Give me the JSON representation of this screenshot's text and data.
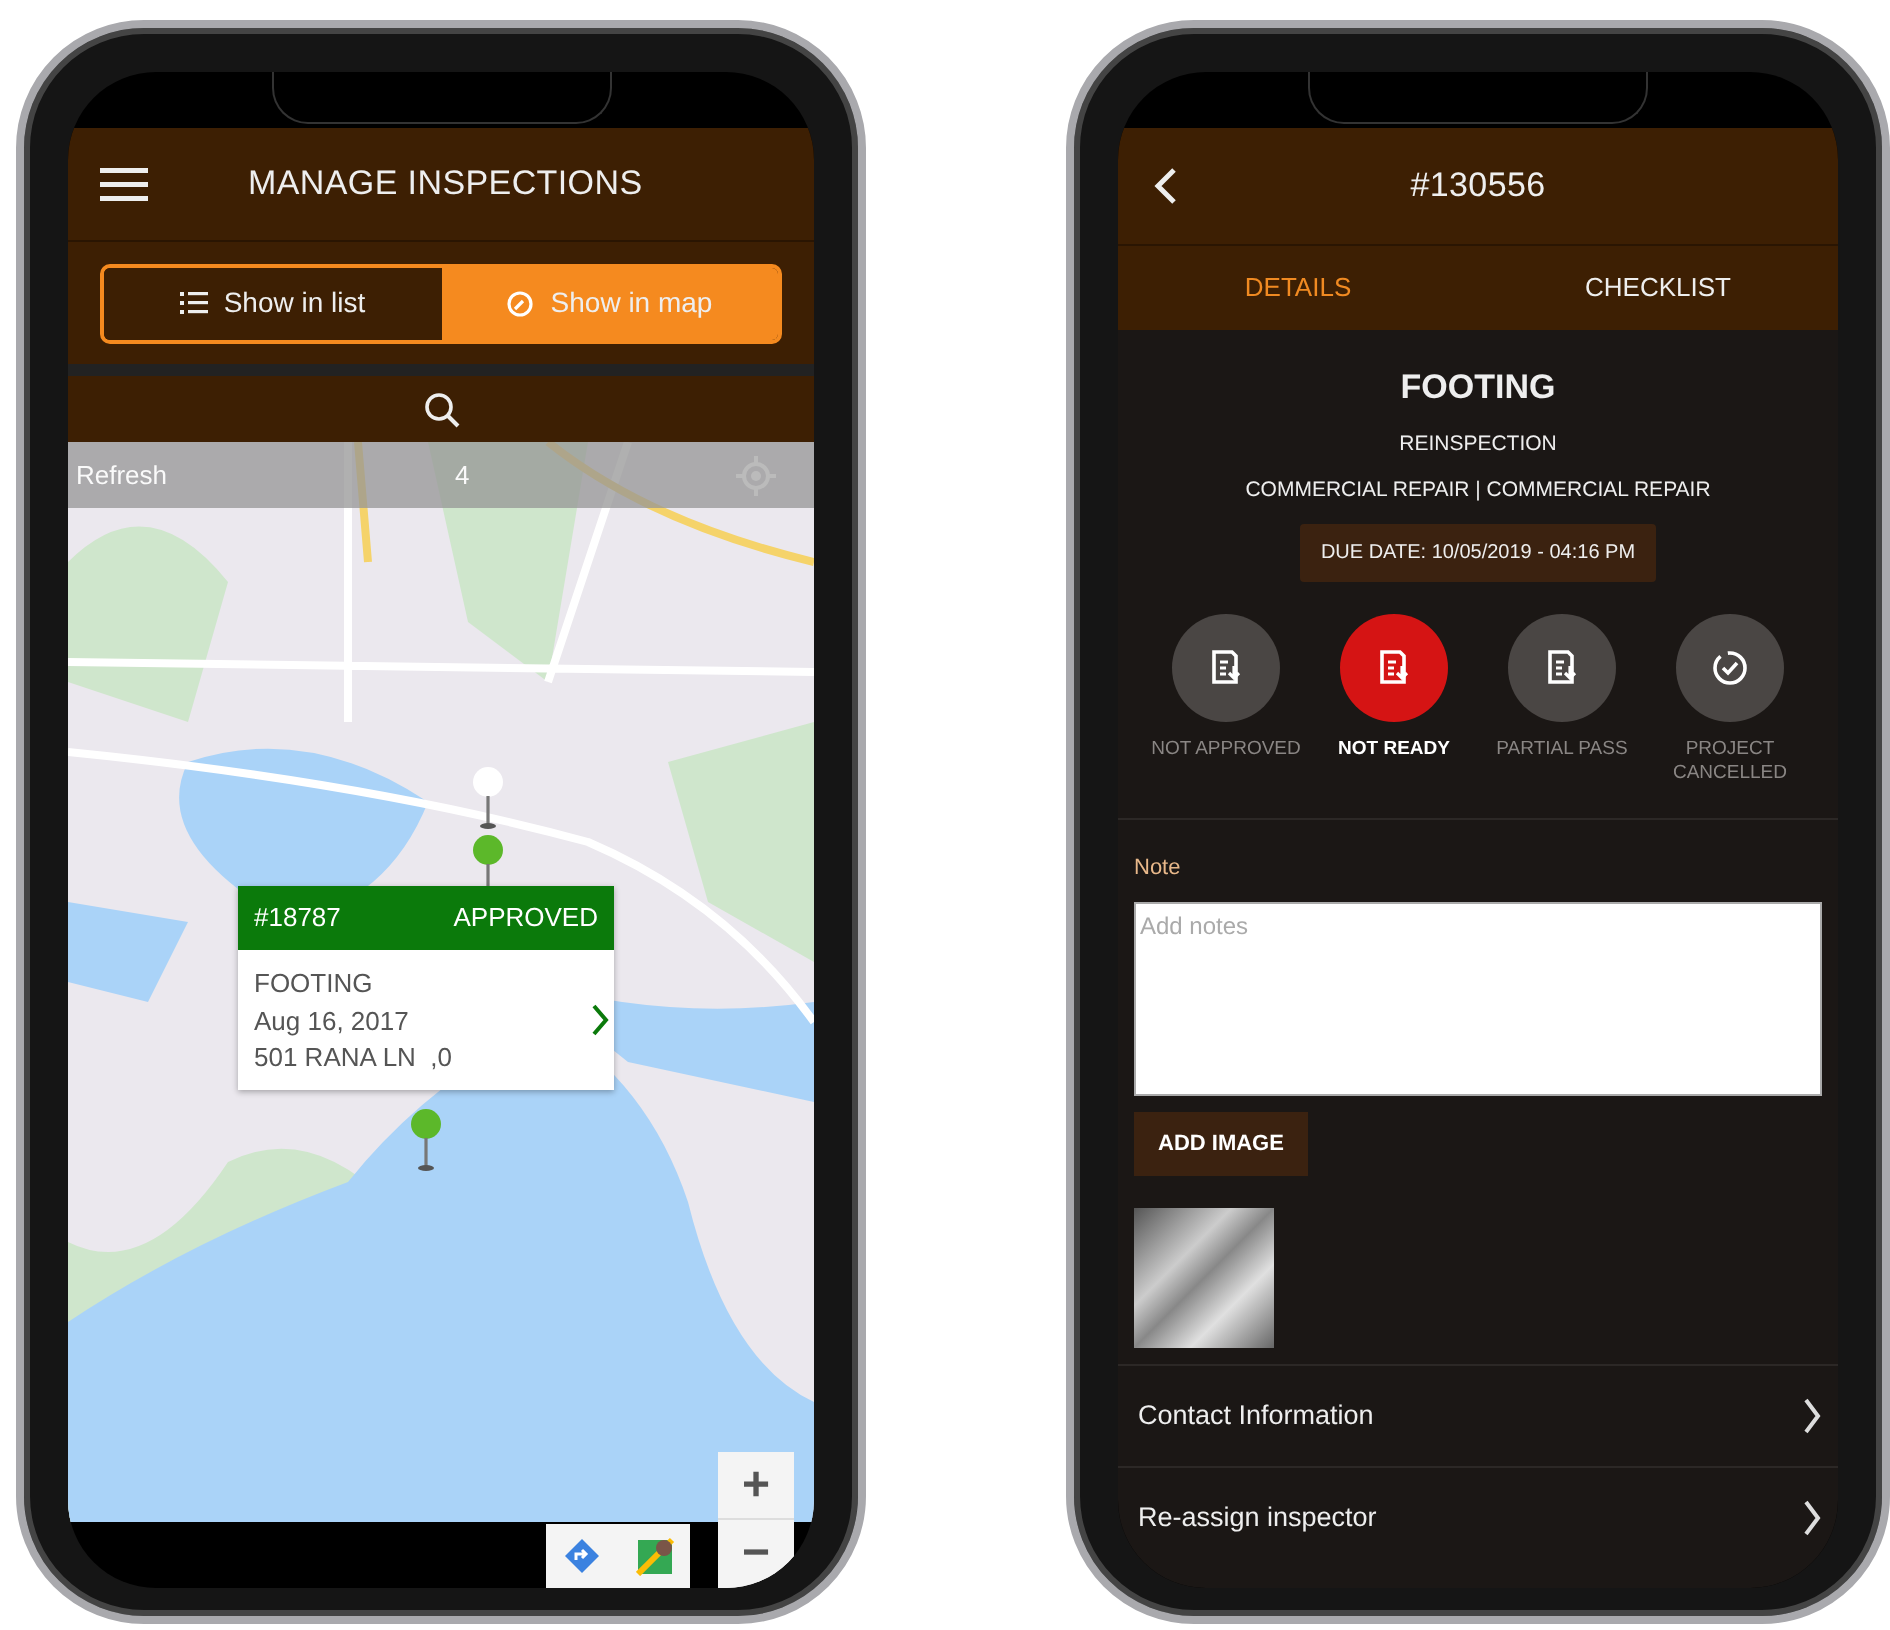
{
  "map_screen": {
    "title": "MANAGE INSPECTIONS",
    "view_toggle": [
      {
        "label": "Show in list",
        "selected": false,
        "kind": "list"
      },
      {
        "label": "Show in map",
        "selected": true,
        "kind": "map"
      }
    ],
    "refresh_bar": {
      "label": "Refresh",
      "count": "4"
    },
    "popup": {
      "number": "#18787",
      "status": "APPROVED",
      "title": "FOOTING",
      "date": "Aug 16, 2017",
      "address": "501 RANA LN  ,0"
    },
    "zoom_controls": [
      "+",
      "−"
    ]
  },
  "detail_screen": {
    "title": "#130556",
    "tabs": [
      {
        "label": "DETAILS",
        "selected": true
      },
      {
        "label": "CHECKLIST",
        "selected": false
      }
    ],
    "heading": "FOOTING",
    "subtitle": "REINSPECTION",
    "type_line": "COMMERCIAL REPAIR | COMMERCIAL REPAIR",
    "due_date": "DUE DATE: 10/05/2019 - 04:16 PM",
    "results": [
      {
        "label": "NOT APPROVED",
        "selected": false,
        "kind": "document"
      },
      {
        "label": "NOT READY",
        "selected": true,
        "kind": "document"
      },
      {
        "label": "PARTIAL PASS",
        "selected": false,
        "kind": "document"
      },
      {
        "label": "PROJECT CANCELLED",
        "selected": false,
        "kind": "check"
      }
    ],
    "note": {
      "label": "Note",
      "placeholder": "Add notes"
    },
    "add_image_button": "ADD IMAGE",
    "links": [
      "Contact Information",
      "Re-assign inspector"
    ]
  }
}
